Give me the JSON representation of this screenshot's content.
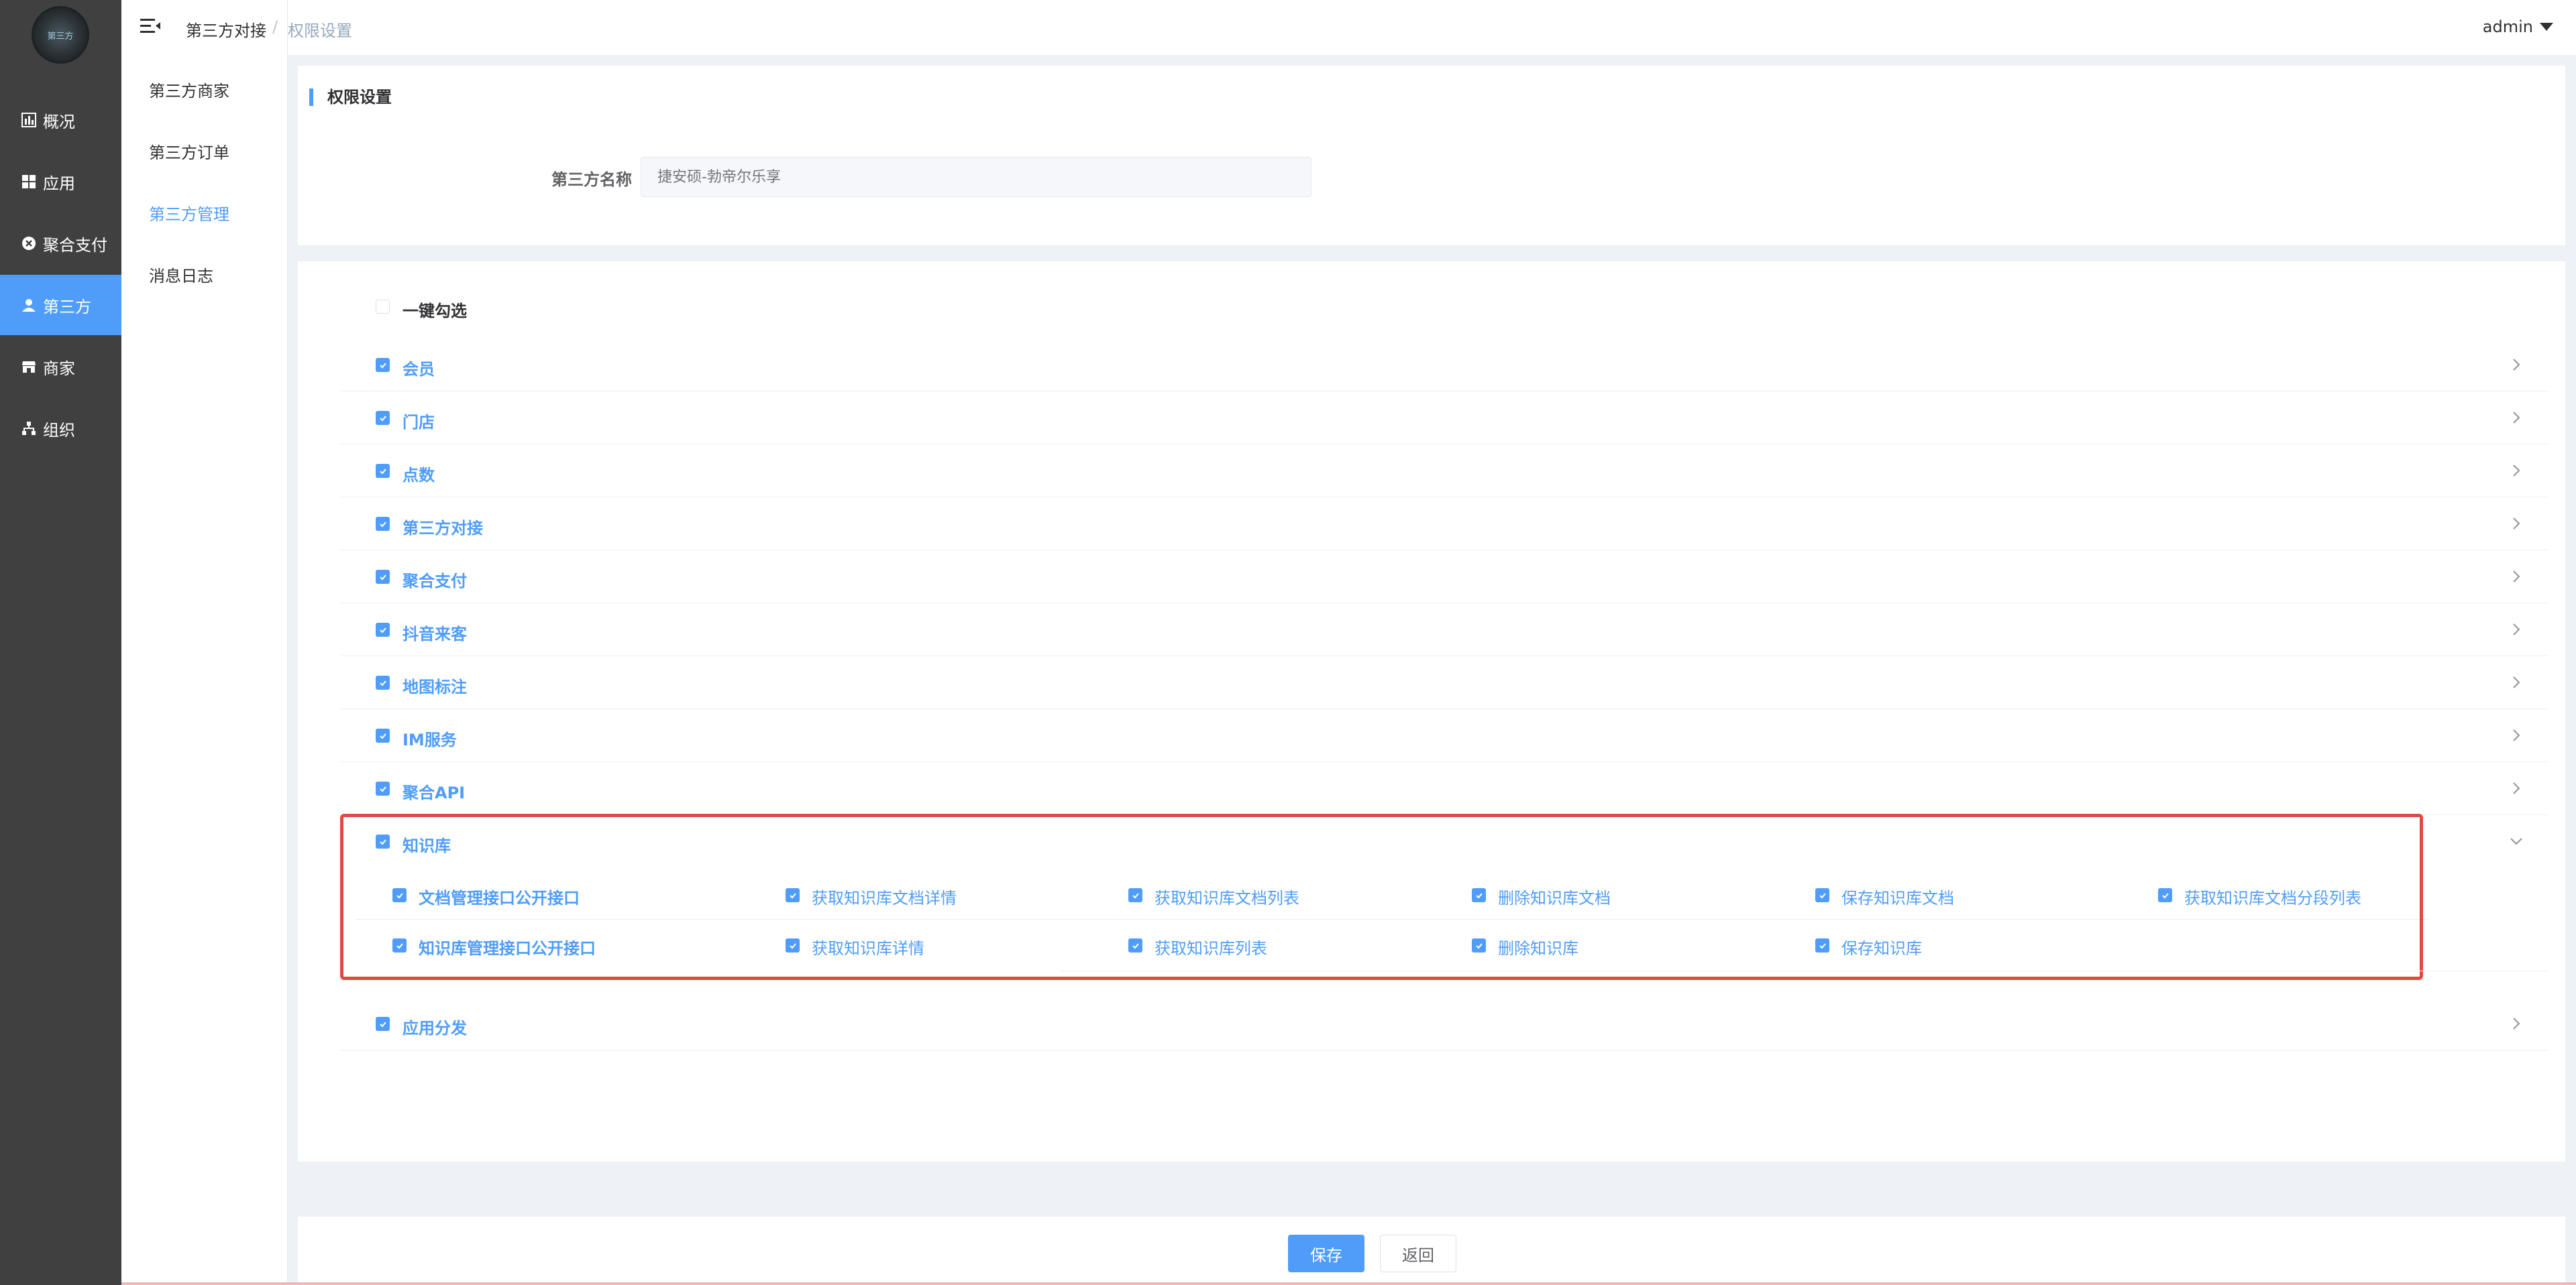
{
  "sidebar": {
    "logo_text": "第三方",
    "items": [
      {
        "label": "概况",
        "icon": "bar-chart-icon"
      },
      {
        "label": "应用",
        "icon": "grid-icon"
      },
      {
        "label": "聚合支付",
        "icon": "close-circle-icon"
      },
      {
        "label": "第三方",
        "icon": "person-icon"
      },
      {
        "label": "商家",
        "icon": "store-icon"
      },
      {
        "label": "组织",
        "icon": "org-tree-icon"
      }
    ],
    "active_index": 3
  },
  "submenu": {
    "items": [
      "第三方商家",
      "第三方订单",
      "第三方管理",
      "消息日志"
    ],
    "active_index": 2
  },
  "header": {
    "breadcrumb": [
      "第三方对接",
      "权限设置"
    ],
    "separator": "/",
    "user": "admin"
  },
  "form": {
    "title": "权限设置",
    "name_label": "第三方名称",
    "name_placeholder": "捷安硕-勃帝尔乐享"
  },
  "permissions": {
    "select_all_label": "一键勾选",
    "groups": [
      "会员",
      "门店",
      "点数",
      "第三方对接",
      "聚合支付",
      "抖音来客",
      "地图标注",
      "IM服务",
      "聚合API",
      "知识库",
      "应用分发"
    ],
    "expanded_group": "知识库",
    "expanded_rows": [
      {
        "title": "文档管理接口公开接口",
        "items": [
          "获取知识库文档详情",
          "获取知识库文档列表",
          "删除知识库文档",
          "保存知识库文档",
          "获取知识库文档分段列表"
        ]
      },
      {
        "title": "知识库管理接口公开接口",
        "items": [
          "获取知识库详情",
          "获取知识库列表",
          "删除知识库",
          "保存知识库"
        ]
      }
    ]
  },
  "actions": {
    "save": "保存",
    "back": "返回"
  },
  "colors": {
    "primary": "#4f9df9",
    "sidebar_bg": "#404040",
    "highlight_border": "#e04b40"
  }
}
